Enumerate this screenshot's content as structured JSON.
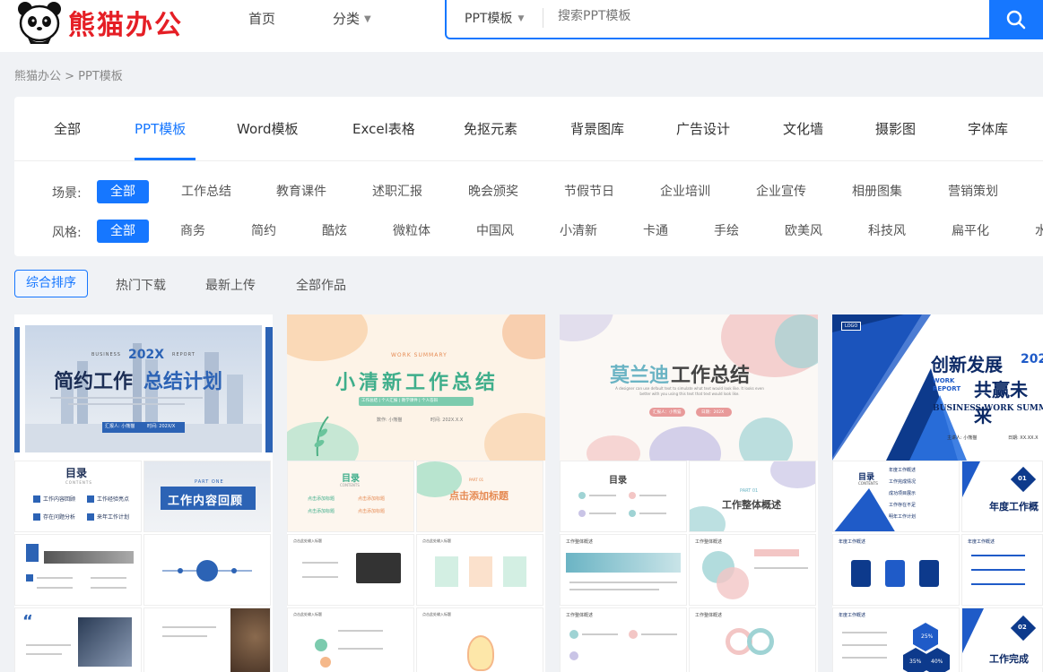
{
  "header": {
    "logo_text": "熊猫办公",
    "nav_home": "首页",
    "nav_category": "分类",
    "search_type": "PPT模板",
    "search_placeholder": "搜索PPT模板"
  },
  "breadcrumb": "熊猫办公 > PPT模板",
  "tabs": [
    "全部",
    "PPT模板",
    "Word模板",
    "Excel表格",
    "免抠元素",
    "背景图库",
    "广告设计",
    "文化墙",
    "摄影图",
    "字体库"
  ],
  "filters": {
    "scene_label": "场景:",
    "scenes": [
      "全部",
      "工作总结",
      "教育课件",
      "述职汇报",
      "晚会颁奖",
      "节假节日",
      "企业培训",
      "企业宣传",
      "相册图集",
      "营销策划"
    ],
    "style_label": "风格:",
    "styles": [
      "全部",
      "商务",
      "简约",
      "酷炫",
      "微粒体",
      "中国风",
      "小清新",
      "卡通",
      "手绘",
      "欧美风",
      "科技风",
      "扁平化",
      "水"
    ]
  },
  "sort": [
    "综合排序",
    "热门下载",
    "最新上传",
    "全部作品"
  ],
  "templates": [
    {
      "cover_title_a": "简约工作",
      "cover_title_b": "总结计划",
      "cover_year": "202X",
      "cover_tag_left": "BUSINESS",
      "cover_tag_right": "REPORT",
      "cover_meta_a": "汇报人: 小熊猫",
      "cover_meta_b": "时间: 202X/X",
      "toc_title": "目录",
      "toc_sub": "CONTENTS",
      "toc_items": [
        "工作内容回顾",
        "工作经验亮点",
        "存在问题分析",
        "来年工作计划"
      ],
      "part_label": "PART ONE",
      "part_title": "工作内容回顾"
    },
    {
      "cover_tag": "WORK SUMMARY",
      "cover_title": "小清新工作总结",
      "cover_sub": "工作总结 | 个人汇报 | 教学课件 | 个人答辩",
      "cover_meta_a": "数作: 小熊猫",
      "cover_meta_b": "时间: 202X.X.X",
      "toc_title": "目录",
      "toc_sub": "CONTENTS",
      "toc_items": [
        "点击添加标题",
        "点击添加标题",
        "点击添加标题",
        "点击添加标题"
      ],
      "part_label": "PART 01",
      "part_title": "点击添加标题",
      "slide_header": "点击此处输入标题"
    },
    {
      "cover_title_a": "莫兰迪",
      "cover_title_b": "工作总结",
      "cover_en": "A designer can use default text to simulate what text would look like. It looks even better with you using this text that text would look like.",
      "cover_meta_a": "汇报人：小熊猫",
      "cover_meta_b": "日期：202X",
      "toc_title": "目录",
      "part_label": "PART 01",
      "part_title": "工作整体概述",
      "slide_header": "工作整体概述"
    },
    {
      "cover_logo": "LOGO",
      "cover_title_a": "创新发展",
      "cover_title_b": "共赢未来",
      "cover_year": "202",
      "cover_tag": "WORK REPORT",
      "cover_en": "BUSINESS WORK SUMMA",
      "cover_meta_a": "主讲人: 小熊猫",
      "cover_meta_b": "日期: XX.XX.X",
      "toc_title": "目录",
      "toc_sub": "CONTENTS",
      "toc_items": [
        "年度工作概述",
        "工作完成情况",
        "成功项目展示",
        "工作存在不足",
        "明年工作计划"
      ],
      "part_num_a": "01",
      "part_title_a": "年度工作概",
      "part_num_b": "02",
      "part_title_b": "工作完成",
      "slide_header_a": "年度工作概述",
      "slide_header_b": "年度工作概述",
      "pct_a": "25%",
      "pct_b": "35%",
      "pct_c": "40%"
    }
  ],
  "colors": {
    "accent": "#1677ff",
    "logo_red": "#e51e25"
  }
}
